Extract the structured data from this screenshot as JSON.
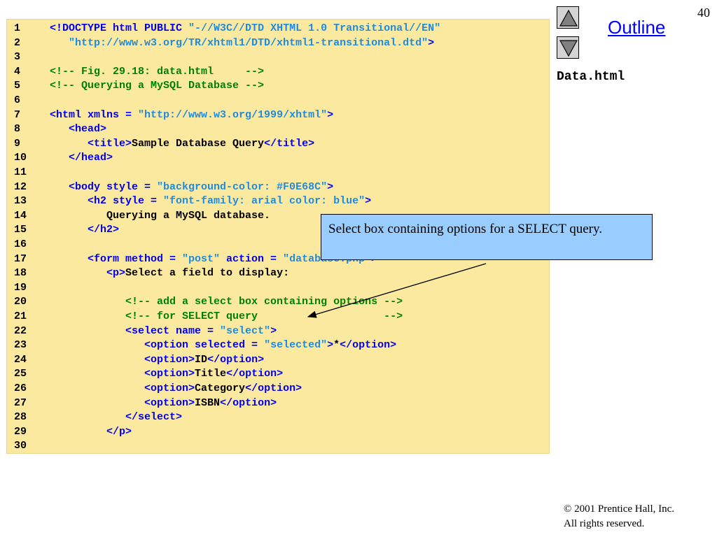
{
  "page_number": "40",
  "sidebar": {
    "outline_label": "Outline",
    "file_name": "Data.html",
    "up_icon": "triangle-up-icon",
    "down_icon": "triangle-down-icon"
  },
  "colors": {
    "code_background": "#fce9a0",
    "tag": "#0000ee",
    "string": "#1f8bde",
    "comment": "#008000",
    "text": "#000000",
    "callout_background": "#99ccff",
    "outline_link": "#0000ff"
  },
  "callout": {
    "text": "Select box containing options for a SELECT query."
  },
  "copyright": {
    "line1": "© 2001 Prentice Hall, Inc.",
    "line2": "All rights reserved."
  },
  "code_lines": [
    {
      "n": "1",
      "tokens": [
        [
          "t",
          "<!DOCTYPE html PUBLIC "
        ],
        [
          "s",
          "\"-//W3C//DTD XHTML 1.0 Transitional//EN\""
        ]
      ]
    },
    {
      "n": "2",
      "tokens": [
        [
          "s",
          "   \"http://www.w3.org/TR/xhtml1/DTD/xhtml1-transitional.dtd\""
        ],
        [
          "t",
          ">"
        ]
      ]
    },
    {
      "n": "3",
      "tokens": []
    },
    {
      "n": "4",
      "tokens": [
        [
          "c",
          "<!-- Fig. 29.18: data.html     -->"
        ]
      ]
    },
    {
      "n": "5",
      "tokens": [
        [
          "c",
          "<!-- Querying a MySQL Database -->"
        ]
      ]
    },
    {
      "n": "6",
      "tokens": []
    },
    {
      "n": "7",
      "tokens": [
        [
          "t",
          "<html xmlns = "
        ],
        [
          "s",
          "\"http://www.w3.org/1999/xhtml\""
        ],
        [
          "t",
          ">"
        ]
      ]
    },
    {
      "n": "8",
      "tokens": [
        [
          "t",
          "   <head>"
        ]
      ]
    },
    {
      "n": "9",
      "tokens": [
        [
          "t",
          "      <title>"
        ],
        [
          "x",
          "Sample Database Query"
        ],
        [
          "t",
          "</title>"
        ]
      ]
    },
    {
      "n": "10",
      "tokens": [
        [
          "t",
          "   </head>"
        ]
      ]
    },
    {
      "n": "11",
      "tokens": []
    },
    {
      "n": "12",
      "tokens": [
        [
          "t",
          "   <body style = "
        ],
        [
          "s",
          "\"background-color: #F0E68C\""
        ],
        [
          "t",
          ">"
        ]
      ]
    },
    {
      "n": "13",
      "tokens": [
        [
          "t",
          "      <h2 style = "
        ],
        [
          "s",
          "\"font-family: arial color: blue\""
        ],
        [
          "t",
          ">"
        ]
      ]
    },
    {
      "n": "14",
      "tokens": [
        [
          "x",
          "         Querying a MySQL database."
        ]
      ]
    },
    {
      "n": "15",
      "tokens": [
        [
          "t",
          "      </h2>"
        ]
      ]
    },
    {
      "n": "16",
      "tokens": []
    },
    {
      "n": "17",
      "tokens": [
        [
          "t",
          "      <form method = "
        ],
        [
          "s",
          "\"post\""
        ],
        [
          "t",
          " action = "
        ],
        [
          "s",
          "\"database.php\""
        ],
        [
          "t",
          ">"
        ]
      ]
    },
    {
      "n": "18",
      "tokens": [
        [
          "t",
          "         <p>"
        ],
        [
          "x",
          "Select a field to display:"
        ]
      ]
    },
    {
      "n": "19",
      "tokens": []
    },
    {
      "n": "20",
      "tokens": [
        [
          "c",
          "            <!-- add a select box containing options -->"
        ]
      ]
    },
    {
      "n": "21",
      "tokens": [
        [
          "c",
          "            <!-- for SELECT query                    -->"
        ]
      ]
    },
    {
      "n": "22",
      "tokens": [
        [
          "t",
          "            <select name = "
        ],
        [
          "s",
          "\"select\""
        ],
        [
          "t",
          ">"
        ]
      ]
    },
    {
      "n": "23",
      "tokens": [
        [
          "t",
          "               <option selected = "
        ],
        [
          "s",
          "\"selected\""
        ],
        [
          "t",
          ">"
        ],
        [
          "x",
          "*"
        ],
        [
          "t",
          "</option>"
        ]
      ]
    },
    {
      "n": "24",
      "tokens": [
        [
          "t",
          "               <option>"
        ],
        [
          "x",
          "ID"
        ],
        [
          "t",
          "</option>"
        ]
      ]
    },
    {
      "n": "25",
      "tokens": [
        [
          "t",
          "               <option>"
        ],
        [
          "x",
          "Title"
        ],
        [
          "t",
          "</option>"
        ]
      ]
    },
    {
      "n": "26",
      "tokens": [
        [
          "t",
          "               <option>"
        ],
        [
          "x",
          "Category"
        ],
        [
          "t",
          "</option>"
        ]
      ]
    },
    {
      "n": "27",
      "tokens": [
        [
          "t",
          "               <option>"
        ],
        [
          "x",
          "ISBN"
        ],
        [
          "t",
          "</option>"
        ]
      ]
    },
    {
      "n": "28",
      "tokens": [
        [
          "t",
          "            </select>"
        ]
      ]
    },
    {
      "n": "29",
      "tokens": [
        [
          "t",
          "         </p>"
        ]
      ]
    },
    {
      "n": "30",
      "tokens": []
    }
  ]
}
